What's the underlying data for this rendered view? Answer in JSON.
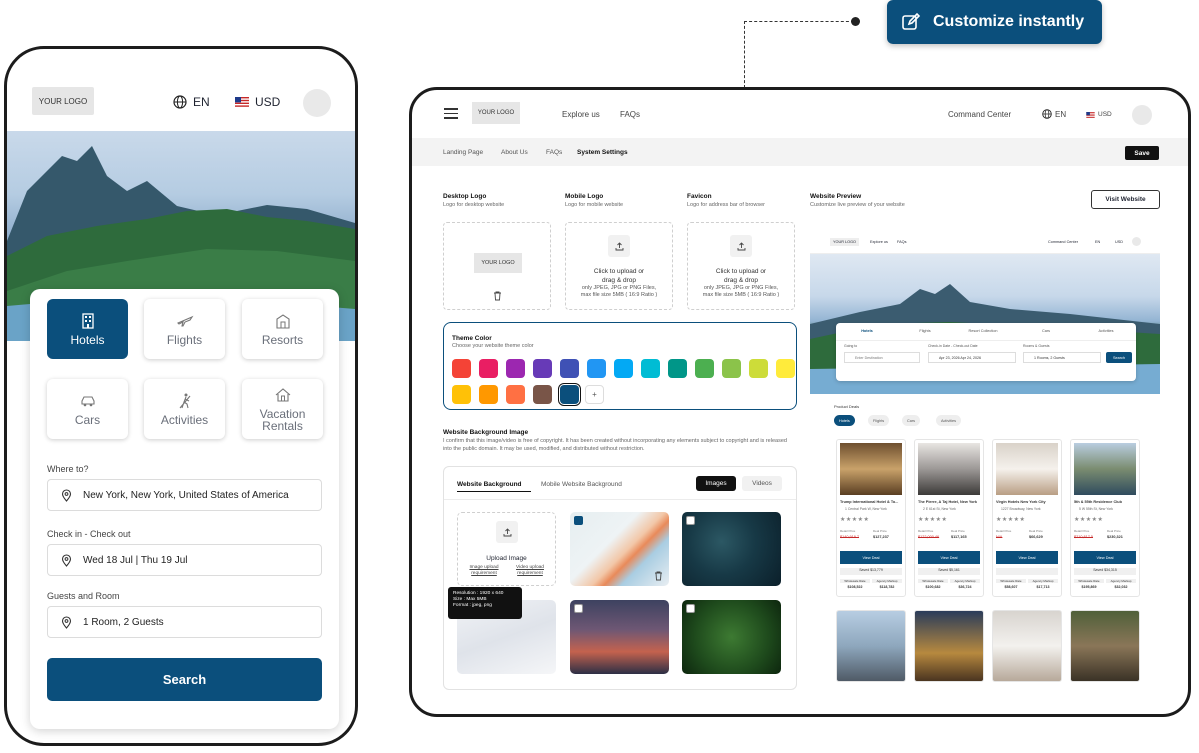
{
  "customize_badge": {
    "label": "Customize instantly"
  },
  "phone": {
    "logo": "YOUR LOGO",
    "language": "EN",
    "currency": "USD",
    "categories": [
      {
        "label": "Hotels",
        "icon": "hotel-icon",
        "active": true
      },
      {
        "label": "Flights",
        "icon": "plane-icon"
      },
      {
        "label": "Resorts",
        "icon": "resort-icon"
      },
      {
        "label": "Cars",
        "icon": "car-icon"
      },
      {
        "label": "Activities",
        "icon": "hiking-icon"
      },
      {
        "label": "Vacation Rentals",
        "icon": "house-icon"
      }
    ],
    "where_label": "Where to?",
    "where_value": "New York, New York, United States of America",
    "dates_label": "Check in - Check out",
    "dates_value": "Wed 18 Jul | Thu 19 Jul",
    "guests_label": "Guests and Room",
    "guests_value": "1 Room, 2 Guests",
    "search_label": "Search"
  },
  "desktop": {
    "logo": "YOUR LOGO",
    "nav": {
      "explore": "Explore us",
      "faqs": "FAQs",
      "command_center": "Command Center",
      "language": "EN",
      "currency": "USD"
    },
    "subnav": [
      "Landing Page",
      "About Us",
      "FAQs",
      "System Settings"
    ],
    "save_label": "Save",
    "desktop_logo": {
      "title": "Desktop Logo",
      "sub": "Logo for desktop website",
      "placeholder": "YOUR LOGO"
    },
    "mobile_logo": {
      "title": "Mobile Logo",
      "sub": "Logo for mobile website"
    },
    "favicon": {
      "title": "Favicon",
      "sub": "Logo for address bar of browser"
    },
    "upload_text": {
      "line1": "Click to upload or",
      "line2": "drag & drop",
      "line3": "only JPEG, JPG or PNG Files,",
      "line4": "max file size 5MB ( 16:9 Ratio )"
    },
    "theme": {
      "title": "Theme Color",
      "sub": "Choose your website theme color",
      "colors": [
        "#f44336",
        "#e91e63",
        "#9c27b0",
        "#673ab7",
        "#3f51b5",
        "#2196f3",
        "#03a9f4",
        "#00bcd4",
        "#009688",
        "#4caf50",
        "#8bc34a",
        "#cddc39",
        "#ffeb3b",
        "#ffc107",
        "#ff9800",
        "#ff7043",
        "#795548",
        "#0b4f7c"
      ],
      "add_label": "+"
    },
    "bg_image": {
      "title": "Website Background Image",
      "disclaimer": "I confirm that this image/video is free of copyright. It has been created without incorporating any elements subject to copyright and is released into the public domain. It may be used, modified, and distributed without restriction.",
      "tabs": [
        "Website Background",
        "Mobile Website Background"
      ],
      "toggle": [
        "Images",
        "Videos"
      ],
      "upload_label": "Upload Image",
      "image_req": "Image upload requirement",
      "video_req": "Video upload requirement",
      "tooltip": [
        "Resolution : 1920 x 640",
        "Size : Max 5MB",
        "Format : jpeg, png"
      ]
    },
    "preview": {
      "title": "Website Preview",
      "sub": "Customize live preview of your website",
      "visit_label": "Visit Website",
      "mini_nav": [
        "YOUR LOGO",
        "Explore us",
        "FAQs",
        "Command Center",
        "EN",
        "USD"
      ],
      "mini_tabs": [
        "Hotels",
        "Flights",
        "Resort Collection",
        "Cars",
        "Activities"
      ],
      "mini_fields": {
        "going_label": "Going to",
        "going_value": "Enter Destination",
        "dates_label": "Check-in Date - Check-out Date",
        "dates_value": "Apr 23, 2026 Apr 24, 2026",
        "rooms_label": "Rooms & Guests",
        "rooms_value": "1 Rooms, 2 Guests",
        "search": "Search"
      },
      "deals_title": "Product Deals",
      "deal_tabs": [
        "Hotels",
        "Flights",
        "Cars",
        "Activities"
      ],
      "hotels": [
        {
          "name": "Trump International Hotel & To...",
          "addr": "1 Central Park W, New York",
          "old": "$140,919.7",
          "price": "$127,237",
          "btn": "View Deal",
          "saved": "Saved $13,779",
          "wholesale": "$108,522",
          "agency": "$118,782"
        },
        {
          "name": "The Pierre, A Taj Hotel, New York",
          "addr": "2 E 61st St, New York",
          "old": "$122,000.46",
          "price": "$117,165",
          "btn": "View Deal",
          "saved": "Saved $5,161",
          "wholesale": "$100,682",
          "agency": "$36,724"
        },
        {
          "name": "Virgin Hotels New York City",
          "addr": "1227 Broadway, New York",
          "old": "N/A",
          "price": "$66,629",
          "btn": "View Deal",
          "saved": "",
          "wholesale": "$58,607",
          "agency": "$17,713"
        },
        {
          "name": "5th & 55th Residence Club",
          "addr": "5 W 55th St, New York",
          "old": "$210,817.5",
          "price": "$230,321",
          "btn": "View Deal",
          "saved": "Saved $34,315",
          "wholesale": "$195,869",
          "agency": "$32,032"
        }
      ],
      "labels": {
        "retail": "Retail Price",
        "deal": "Deal Price",
        "wholesale": "Wholesale Rate",
        "agency": "Agency Markup"
      }
    }
  }
}
